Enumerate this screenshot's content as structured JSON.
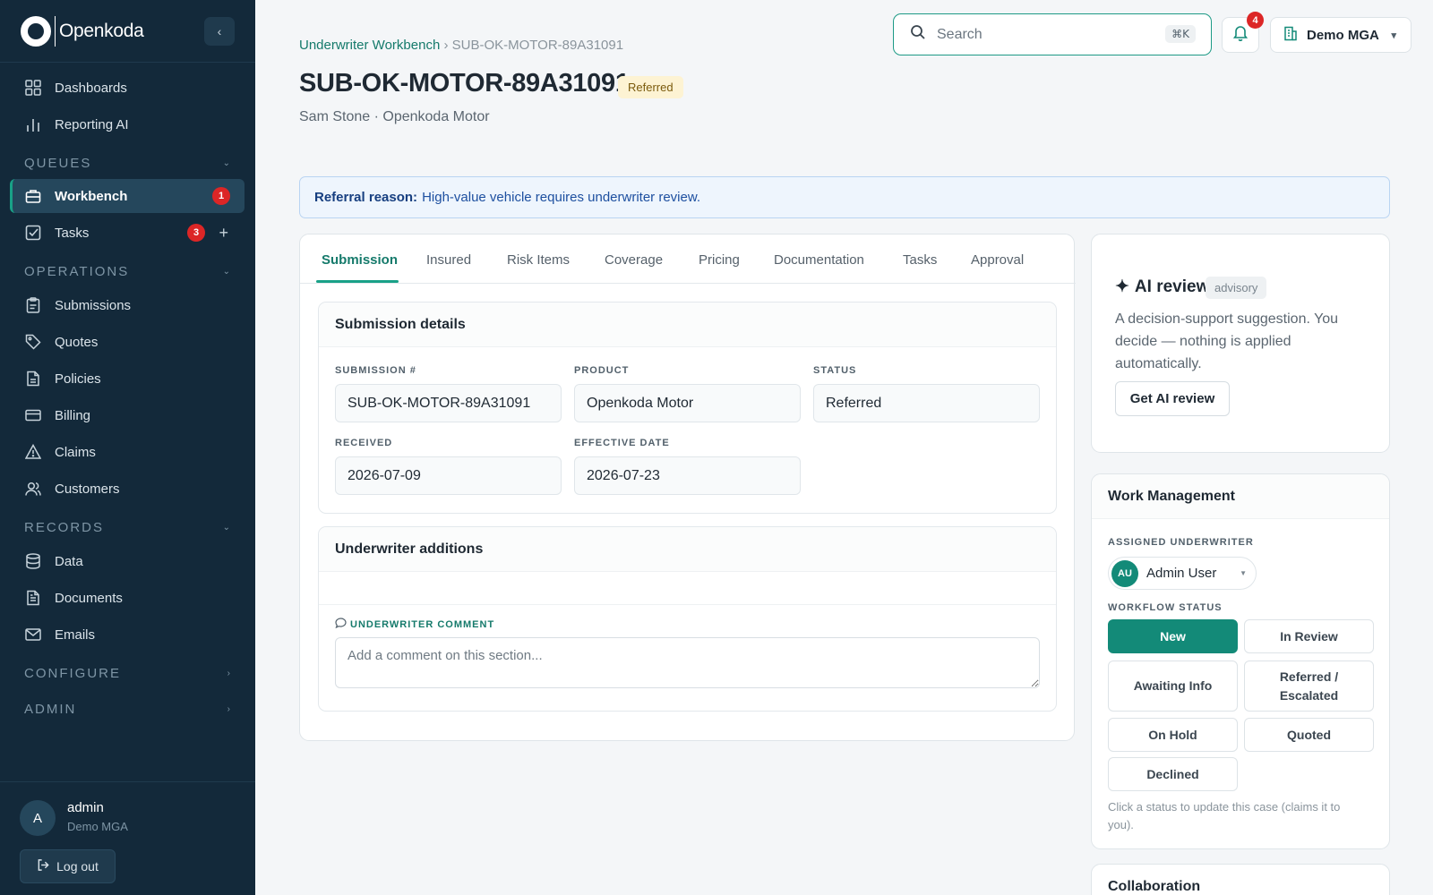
{
  "brand": {
    "name": "Openkoda"
  },
  "sidebar": {
    "items": [
      {
        "label": "Dashboards",
        "icon": "grid-icon"
      },
      {
        "label": "Reporting AI",
        "icon": "bar-chart-icon"
      },
      {
        "label": "Workbench",
        "icon": "briefcase-icon",
        "badge": "1",
        "active": true
      },
      {
        "label": "Tasks",
        "icon": "checkbox-icon",
        "badge": "3"
      },
      {
        "label": "Submissions",
        "icon": "clipboard-icon"
      },
      {
        "label": "Quotes",
        "icon": "tag-icon"
      },
      {
        "label": "Policies",
        "icon": "file-icon"
      },
      {
        "label": "Billing",
        "icon": "credit-card-icon"
      },
      {
        "label": "Claims",
        "icon": "warning-icon"
      },
      {
        "label": "Customers",
        "icon": "users-icon"
      },
      {
        "label": "Data",
        "icon": "database-icon"
      },
      {
        "label": "Documents",
        "icon": "document-icon"
      },
      {
        "label": "Emails",
        "icon": "mail-icon"
      }
    ],
    "sections": [
      "QUEUES",
      "OPERATIONS",
      "RECORDS",
      "CONFIGURE",
      "ADMIN"
    ],
    "user": {
      "initial": "A",
      "name": "admin",
      "org": "Demo MGA"
    },
    "logout_label": "Log out"
  },
  "topbar": {
    "search_placeholder": "Search",
    "search_shortcut": "⌘K",
    "notifications_count": "4",
    "org_name": "Demo MGA"
  },
  "header": {
    "breadcrumb_link": "Underwriter Workbench",
    "breadcrumb_sep": "›",
    "breadcrumb_current": "SUB-OK-MOTOR-89A31091",
    "title": "SUB-OK-MOTOR-89A31091",
    "status_badge": "Referred",
    "subtitle": "Sam Stone · Openkoda Motor"
  },
  "referral": {
    "label": "Referral reason:",
    "text": "High-value vehicle requires underwriter review."
  },
  "tabs": [
    "Submission",
    "Insured",
    "Risk Items",
    "Coverage",
    "Pricing",
    "Documentation",
    "Tasks",
    "Approval"
  ],
  "submission_details": {
    "title": "Submission details",
    "fields": [
      {
        "label": "SUBMISSION #",
        "value": "SUB-OK-MOTOR-89A31091"
      },
      {
        "label": "PRODUCT",
        "value": "Openkoda Motor"
      },
      {
        "label": "STATUS",
        "value": "Referred"
      },
      {
        "label": "RECEIVED",
        "value": "2026-07-09"
      },
      {
        "label": "EFFECTIVE DATE",
        "value": "2026-07-23"
      }
    ]
  },
  "underwriter_additions": {
    "title": "Underwriter additions",
    "comment_label": "UNDERWRITER COMMENT",
    "comment_placeholder": "Add a comment on this section..."
  },
  "ai_review": {
    "title": "AI review",
    "tag": "advisory",
    "description": "A decision-support suggestion. You decide — nothing is applied automatically.",
    "button": "Get AI review"
  },
  "work_management": {
    "title": "Work Management",
    "assigned_label": "ASSIGNED UNDERWRITER",
    "assignee_initials": "AU",
    "assignee_name": "Admin User",
    "workflow_label": "WORKFLOW STATUS",
    "statuses": [
      "New",
      "In Review",
      "Awaiting Info",
      "Referred / Escalated",
      "On Hold",
      "Quoted",
      "Declined"
    ],
    "selected_status": "New",
    "hint": "Click a status to update this case (claims it to you)."
  },
  "collaboration": {
    "title": "Collaboration"
  },
  "colors": {
    "accent": "#138a78",
    "sidebar_bg": "#13293a",
    "badge_red": "#dc2626"
  }
}
